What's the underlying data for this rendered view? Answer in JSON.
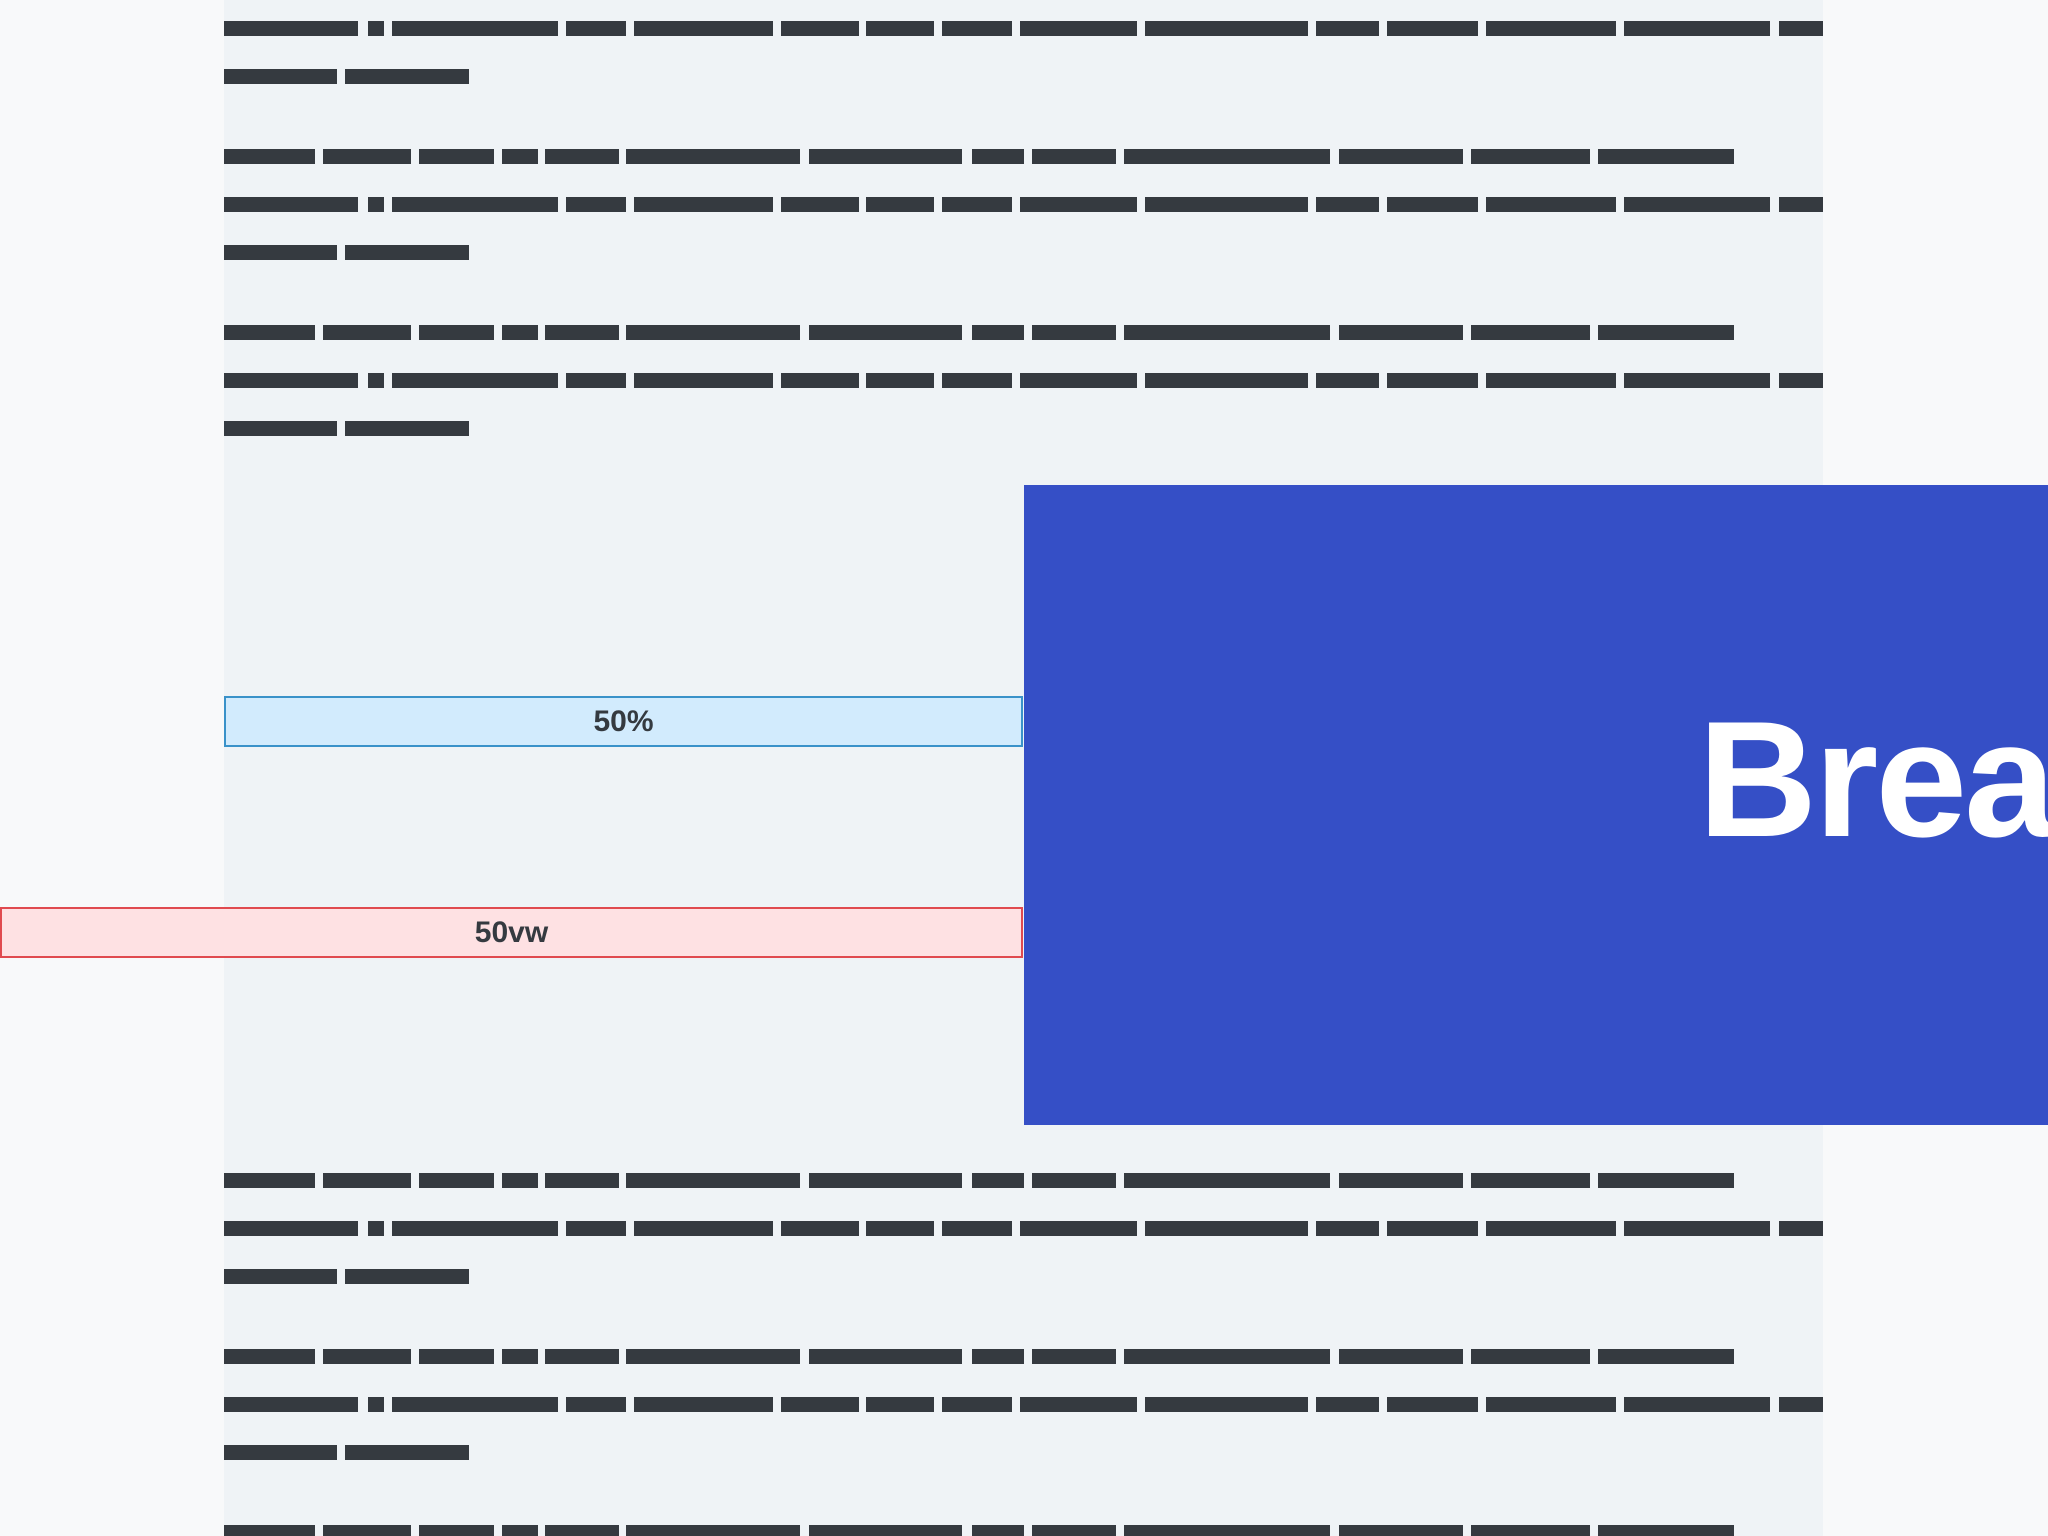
{
  "colors": {
    "page_background": "#f8f9fa",
    "content_column": "#eff3f6",
    "redacted_text": "#353a40",
    "percent_box_fill": "#d2ebfd",
    "percent_box_border": "#3a92c9",
    "vw_box_fill": "#fee1e3",
    "vw_box_border": "#e04a4f",
    "breakout_background": "#354fc6",
    "breakout_text": "#ffffff"
  },
  "labels": {
    "percent_box": "50%",
    "vw_box": "50vw",
    "breakout_title": "Brea"
  }
}
